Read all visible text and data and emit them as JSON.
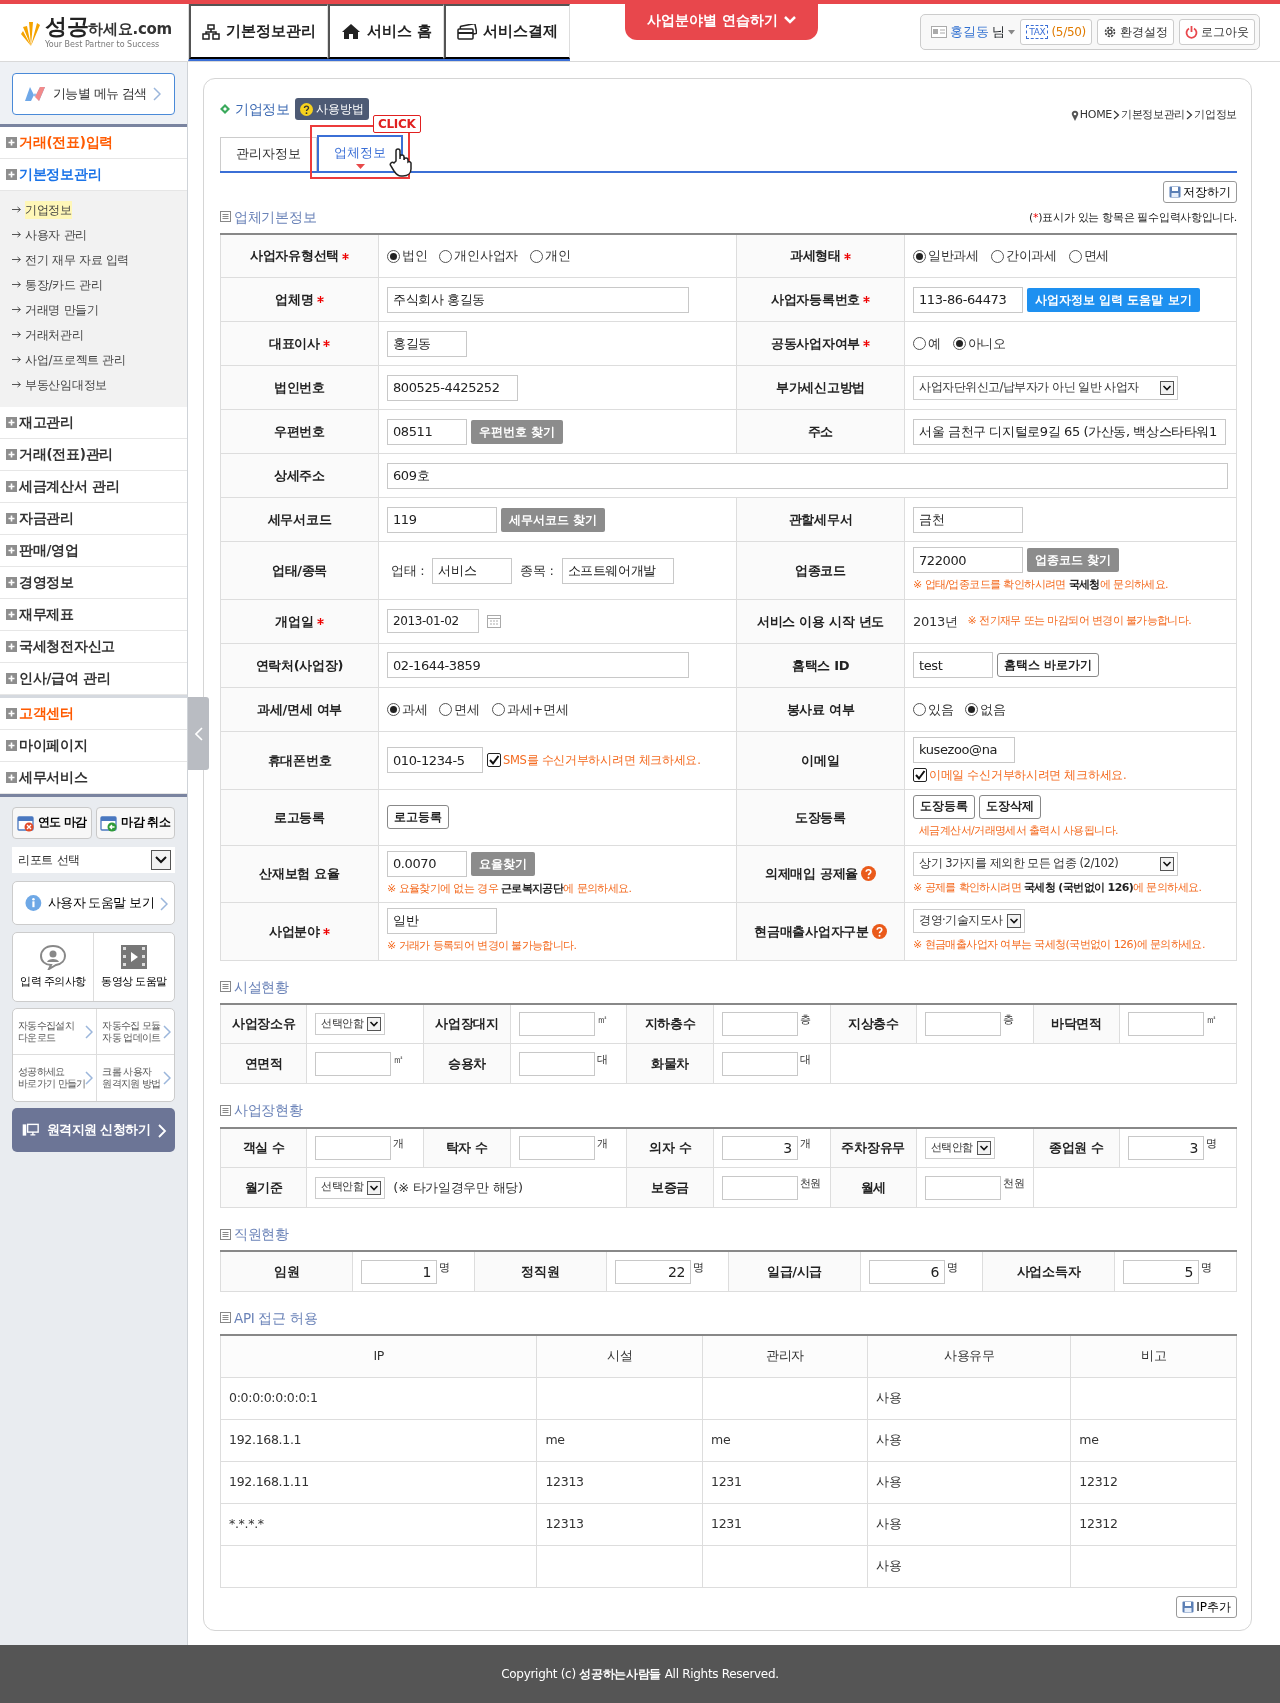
{
  "header": {
    "logo": {
      "main": "성공",
      "rest": "하세요.com",
      "tagline": "Your Best Partner to Success"
    },
    "nav": [
      {
        "label": "기본정보관리"
      },
      {
        "label": "서비스 홈"
      },
      {
        "label": "서비스결제"
      }
    ],
    "practice_button": "사업분야별 연습하기",
    "user": {
      "name": "홍길동",
      "suffix": "님",
      "tax_badge": "TAX",
      "usage": "(5/50)",
      "settings": "환경설정",
      "logout": "로그아웃"
    }
  },
  "sidebar": {
    "search_button": "기능별 메뉴 검색",
    "menu_groups": [
      [
        {
          "label": "거래(전표)입력",
          "color": "#ff5a00"
        },
        {
          "label": "기본정보관리",
          "color": "#1a73e8",
          "children": [
            {
              "label": "기업정보",
              "selected": true
            },
            {
              "label": "사용자 관리",
              "selected": false
            },
            {
              "label": "전기 재무 자료 입력",
              "selected": false
            },
            {
              "label": "통장/카드 관리",
              "selected": false
            },
            {
              "label": "거래명 만들기",
              "selected": false
            },
            {
              "label": "거래처관리",
              "selected": false
            },
            {
              "label": "사업/프로젝트 관리",
              "selected": false
            },
            {
              "label": "부동산임대정보",
              "selected": false
            }
          ]
        },
        {
          "label": "재고관리",
          "color": "#333333"
        },
        {
          "label": "거래(전표)관리",
          "color": "#333333"
        },
        {
          "label": "세금계산서 관리",
          "color": "#333333"
        },
        {
          "label": "자금관리",
          "color": "#333333"
        },
        {
          "label": "판매/영업",
          "color": "#333333"
        },
        {
          "label": "경영정보",
          "color": "#333333"
        },
        {
          "label": "재무제표",
          "color": "#333333"
        },
        {
          "label": "국세청전자신고",
          "color": "#333333"
        },
        {
          "label": "인사/급여 관리",
          "color": "#333333"
        }
      ],
      [
        {
          "label": "고객센터",
          "color": "#ff5a00"
        },
        {
          "label": "마이페이지",
          "color": "#333333"
        },
        {
          "label": "세무서비스",
          "color": "#333333"
        }
      ]
    ],
    "close_buttons": [
      {
        "label": "연도 마감"
      },
      {
        "label": "마감 취소"
      }
    ],
    "report_select": "리포트 선택",
    "help_button": "사용자 도움말 보기",
    "tiles": [
      {
        "label": "입력 주의사항"
      },
      {
        "label": "동영상 도움말"
      }
    ],
    "links": [
      {
        "lines": [
          "자동수집설치",
          "다운로드"
        ]
      },
      {
        "lines": [
          "자동수집 모듈",
          "자동 업데이트"
        ]
      },
      {
        "lines": [
          "성공하세요",
          "바로가기 만들기"
        ]
      },
      {
        "lines": [
          "크롬 사용자",
          "원격지원 방법"
        ]
      }
    ],
    "remote_button": "원격지원 신청하기"
  },
  "page": {
    "title": "기업정보",
    "help_badge": "사용방법",
    "breadcrumb": [
      "HOME",
      "기본정보관리",
      "기업정보"
    ],
    "tabs": [
      {
        "label": "관리자정보",
        "selected": false
      },
      {
        "label": "업체정보",
        "selected": true
      }
    ],
    "callout": "CLICK",
    "save_button": "저장하기"
  },
  "basic_info": {
    "title": "업체기본정보",
    "required_note": {
      "open": "(",
      "mark": "*",
      "close": ")표시가 있는 항목은 필수입력사항입니다."
    },
    "rows": [
      {
        "cells": [
          {
            "label": "사업자유형선택",
            "required": true,
            "parts": [
              {
                "kind": "radio",
                "label": "법인",
                "selected": true
              },
              {
                "kind": "radio",
                "label": "개인사업자",
                "selected": false
              },
              {
                "kind": "radio",
                "label": "개인",
                "selected": false
              }
            ]
          },
          {
            "label": "과세형태",
            "required": true,
            "parts": [
              {
                "kind": "radio",
                "label": "일반과세",
                "selected": true
              },
              {
                "kind": "radio",
                "label": "간이과세",
                "selected": false
              },
              {
                "kind": "radio",
                "label": "면세",
                "selected": false
              }
            ]
          }
        ]
      },
      {
        "cells": [
          {
            "label": "업체명",
            "required": true,
            "parts": [
              {
                "kind": "long-input",
                "value": "주식회사 홍길동"
              }
            ]
          },
          {
            "label": "사업자등록번호",
            "required": true,
            "parts": [
              {
                "kind": "input",
                "value": "113-86-64473"
              },
              {
                "kind": "primary-button",
                "label": "사업자정보 입력 도움말 보기"
              }
            ]
          }
        ]
      },
      {
        "cells": [
          {
            "label": "대표이사",
            "required": true,
            "parts": [
              {
                "kind": "short-input",
                "value": "홍길동"
              }
            ]
          },
          {
            "label": "공동사업자여부",
            "required": true,
            "parts": [
              {
                "kind": "radio",
                "label": "예",
                "selected": false
              },
              {
                "kind": "radio",
                "label": "아니오",
                "selected": true
              }
            ]
          }
        ]
      },
      {
        "cells": [
          {
            "label": "법인번호",
            "parts": [
              {
                "kind": "input",
                "value": "800525-4425252"
              }
            ]
          },
          {
            "label": "부가세신고방법",
            "parts": [
              {
                "kind": "select",
                "value": "사업자단위신고/납부자가 아닌 일반 사업자"
              }
            ]
          }
        ]
      },
      {
        "cells": [
          {
            "label": "우편번호",
            "parts": [
              {
                "kind": "short-input",
                "value": "08511"
              },
              {
                "kind": "gray-button",
                "label": "우편번호 찾기"
              }
            ]
          },
          {
            "label": "주소",
            "parts": [
              {
                "kind": "long-input",
                "value": "서울 금천구 디지털로9길 65 (가산동, 백상스타타워1"
              }
            ]
          }
        ]
      },
      {
        "cells": [
          {
            "label": "상세주소",
            "parts": [
              {
                "kind": "full-input",
                "value": "609호"
              }
            ]
          }
        ]
      },
      {
        "cells": [
          {
            "label": "세무서코드",
            "parts": [
              {
                "kind": "input",
                "value": "119"
              },
              {
                "kind": "gray-button",
                "label": "세무서코드 찾기"
              }
            ]
          },
          {
            "label": "관할세무서",
            "parts": [
              {
                "kind": "input",
                "value": "금천"
              }
            ]
          }
        ]
      },
      {
        "cells": [
          {
            "label": "업태/종목",
            "parts": [
              {
                "kind": "text",
                "label": "업태 :"
              },
              {
                "kind": "short-input",
                "value": "서비스"
              },
              {
                "kind": "text",
                "label": "종목 :"
              },
              {
                "kind": "short-input",
                "value": "소프트웨어개발"
              }
            ]
          },
          {
            "label": "업종코드",
            "parts": [
              {
                "kind": "input",
                "value": "722000"
              },
              {
                "kind": "gray-button",
                "label": "업종코드 찾기"
              },
              {
                "kind": "note",
                "label": "※ 업태/업종코드를 확인하시려면 **국세청**에 문의하세요."
              }
            ]
          }
        ]
      },
      {
        "cells": [
          {
            "label": "개업일",
            "required": true,
            "parts": [
              {
                "kind": "date-input",
                "value": "2013-01-02"
              }
            ]
          },
          {
            "label": "서비스 이용 시작 년도",
            "parts": [
              {
                "kind": "value-text",
                "label": "2013년"
              },
              {
                "kind": "inline-note",
                "label": "※ 전기재무 또는 마감되어 변경이 불가능합니다."
              }
            ]
          }
        ]
      },
      {
        "cells": [
          {
            "label": "연락처(사업장)",
            "parts": [
              {
                "kind": "long-input",
                "value": "02-1644-3859"
              }
            ]
          },
          {
            "label": "홈택스 ID",
            "parts": [
              {
                "kind": "short-input",
                "value": "test"
              },
              {
                "kind": "outline-button",
                "label": "홈택스 바로가기"
              }
            ]
          }
        ]
      },
      {
        "cells": [
          {
            "label": "과세/면세 여부",
            "parts": [
              {
                "kind": "radio",
                "label": "과세",
                "selected": true
              },
              {
                "kind": "radio",
                "label": "면세",
                "selected": false
              },
              {
                "kind": "radio",
                "label": "과세+면세",
                "selected": false
              }
            ]
          },
          {
            "label": "봉사료 여부",
            "parts": [
              {
                "kind": "radio",
                "label": "있음",
                "selected": false
              },
              {
                "kind": "radio",
                "label": "없음",
                "selected": true
              }
            ]
          }
        ]
      },
      {
        "cells": [
          {
            "label": "휴대폰번호",
            "parts": [
              {
                "kind": "short-input",
                "value": "010-1234-5"
              },
              {
                "kind": "checkbox",
                "label": "SMS를 수신거부하시려면 체크하세요.",
                "checked": true
              }
            ]
          },
          {
            "label": "이메일",
            "parts": [
              {
                "kind": "short-input",
                "value": "kusezoo@na"
              },
              {
                "kind": "checkbox",
                "label": "이메일 수신거부하시려면 체크하세요.",
                "checked": true
              }
            ]
          }
        ]
      },
      {
        "cells": [
          {
            "label": "로고등록",
            "parts": [
              {
                "kind": "outline-button",
                "label": "로고등록"
              }
            ]
          },
          {
            "label": "도장등록",
            "parts": [
              {
                "kind": "outline-button",
                "label": "도장등록"
              },
              {
                "kind": "outline-button",
                "label": "도장삭제"
              },
              {
                "kind": "inline-note",
                "label": "세금계산서/거래명세서 출력시 사용됩니다."
              }
            ]
          }
        ]
      },
      {
        "cells": [
          {
            "label": "산재보험 요율",
            "parts": [
              {
                "kind": "short-input",
                "value": "0.0070"
              },
              {
                "kind": "gray-button",
                "label": "요율찾기"
              },
              {
                "kind": "note",
                "label": "※ 요율찾기에 없는 경우 **근로복지공단**에 문의하세요."
              }
            ]
          },
          {
            "label": "의제매입 공제율",
            "help": true,
            "parts": [
              {
                "kind": "select",
                "value": "상기 3가지를 제외한 모든 업종 (2/102)"
              },
              {
                "kind": "note",
                "label": "※ 공제를 확인하시려면 **국세청 (국번없이 126)**에 문의하세요."
              }
            ]
          }
        ]
      },
      {
        "cells": [
          {
            "label": "사업분야",
            "required": true,
            "parts": [
              {
                "kind": "input",
                "value": "일반"
              },
              {
                "kind": "note",
                "label": "※ 거래가 등록되어 변경이 불가능합니다."
              }
            ]
          },
          {
            "label": "현금매출사업자구분",
            "help": true,
            "parts": [
              {
                "kind": "select",
                "value": "경영·기술지도사"
              },
              {
                "kind": "note",
                "label": "※ 현금매출사업자 여부는 국세청(국번없이 126)에 문의하세요."
              }
            ]
          }
        ]
      }
    ]
  },
  "facilities": {
    "title": "시설현황",
    "rows": [
      {
        "cells": [
          {
            "label": "사업장소유",
            "parts": [
              {
                "kind": "small-select",
                "value": "선택안함"
              }
            ]
          },
          {
            "label": "사업장대지",
            "parts": [
              {
                "kind": "number-input"
              },
              {
                "kind": "unit",
                "label": "㎡"
              }
            ]
          },
          {
            "label": "지하층수",
            "parts": [
              {
                "kind": "number-input"
              },
              {
                "kind": "unit",
                "label": "층"
              }
            ]
          },
          {
            "label": "지상층수",
            "parts": [
              {
                "kind": "number-input"
              },
              {
                "kind": "unit",
                "label": "층"
              }
            ]
          },
          {
            "label": "바닥면적",
            "parts": [
              {
                "kind": "number-input"
              },
              {
                "kind": "unit",
                "label": "㎡"
              }
            ]
          }
        ]
      },
      {
        "cells": [
          {
            "label": "연면적",
            "parts": [
              {
                "kind": "number-input"
              },
              {
                "kind": "unit",
                "label": "㎡"
              }
            ]
          },
          {
            "label": "승용차",
            "parts": [
              {
                "kind": "number-input"
              },
              {
                "kind": "unit",
                "label": "대"
              }
            ]
          },
          {
            "label": "화물차",
            "parts": [
              {
                "kind": "number-input"
              },
              {
                "kind": "unit",
                "label": "대"
              }
            ]
          }
        ]
      }
    ]
  },
  "workplace": {
    "title": "사업장현황",
    "rows": [
      {
        "cells": [
          {
            "label": "객실 수",
            "parts": [
              {
                "kind": "number-input"
              },
              {
                "kind": "unit",
                "label": "개"
              }
            ]
          },
          {
            "label": "탁자 수",
            "parts": [
              {
                "kind": "number-input"
              },
              {
                "kind": "unit",
                "label": "개"
              }
            ]
          },
          {
            "label": "의자 수",
            "parts": [
              {
                "kind": "number-input",
                "value": "3"
              },
              {
                "kind": "unit",
                "label": "개"
              }
            ]
          },
          {
            "label": "주차장유무",
            "parts": [
              {
                "kind": "small-select",
                "value": "선택안함"
              }
            ]
          },
          {
            "label": "종업원 수",
            "parts": [
              {
                "kind": "number-input",
                "value": "3"
              },
              {
                "kind": "unit",
                "label": "명"
              }
            ]
          }
        ]
      },
      {
        "cells": [
          {
            "label": "월기준",
            "parts": [
              {
                "kind": "small-select",
                "value": "선택안함"
              },
              {
                "kind": "text",
                "label": "(※ 타가일경우만 해당)"
              }
            ]
          },
          null,
          {
            "label": "보증금",
            "parts": [
              {
                "kind": "number-input"
              },
              {
                "kind": "unit",
                "label": "천원"
              }
            ]
          },
          {
            "label": "월세",
            "parts": [
              {
                "kind": "number-input"
              },
              {
                "kind": "unit",
                "label": "천원"
              }
            ]
          }
        ]
      }
    ]
  },
  "staff": {
    "title": "직원현황",
    "rows": [
      {
        "cells": [
          {
            "label": "임원",
            "parts": [
              {
                "kind": "number-input",
                "value": "1"
              },
              {
                "kind": "unit",
                "label": "명"
              }
            ]
          },
          {
            "label": "정직원",
            "parts": [
              {
                "kind": "number-input",
                "value": "22"
              },
              {
                "kind": "unit",
                "label": "명"
              }
            ]
          },
          {
            "label": "일급/시급",
            "parts": [
              {
                "kind": "number-input",
                "value": "6"
              },
              {
                "kind": "unit",
                "label": "명"
              }
            ]
          },
          {
            "label": "사업소득자",
            "parts": [
              {
                "kind": "number-input",
                "value": "5"
              },
              {
                "kind": "unit",
                "label": "명"
              }
            ]
          }
        ]
      }
    ]
  },
  "api_access": {
    "title": "API 접근 허용",
    "columns": [
      "IP",
      "시설",
      "관리자",
      "사용유무",
      "비고"
    ],
    "rows": [
      [
        "0:0:0:0:0:0:0:1",
        null,
        null,
        "사용",
        null
      ],
      [
        "192.168.1.1",
        "me",
        "me",
        "사용",
        "me"
      ],
      [
        "192.168.1.11",
        "12313",
        "1231",
        "사용",
        "12312"
      ],
      [
        "*.*.*.*",
        "12313",
        "1231",
        "사용",
        "12312"
      ],
      [
        null,
        null,
        null,
        "사용",
        null
      ]
    ],
    "add_button": "IP추가"
  },
  "footer": "Copyright (c) **성공하는사람들** All Rights Reserved."
}
